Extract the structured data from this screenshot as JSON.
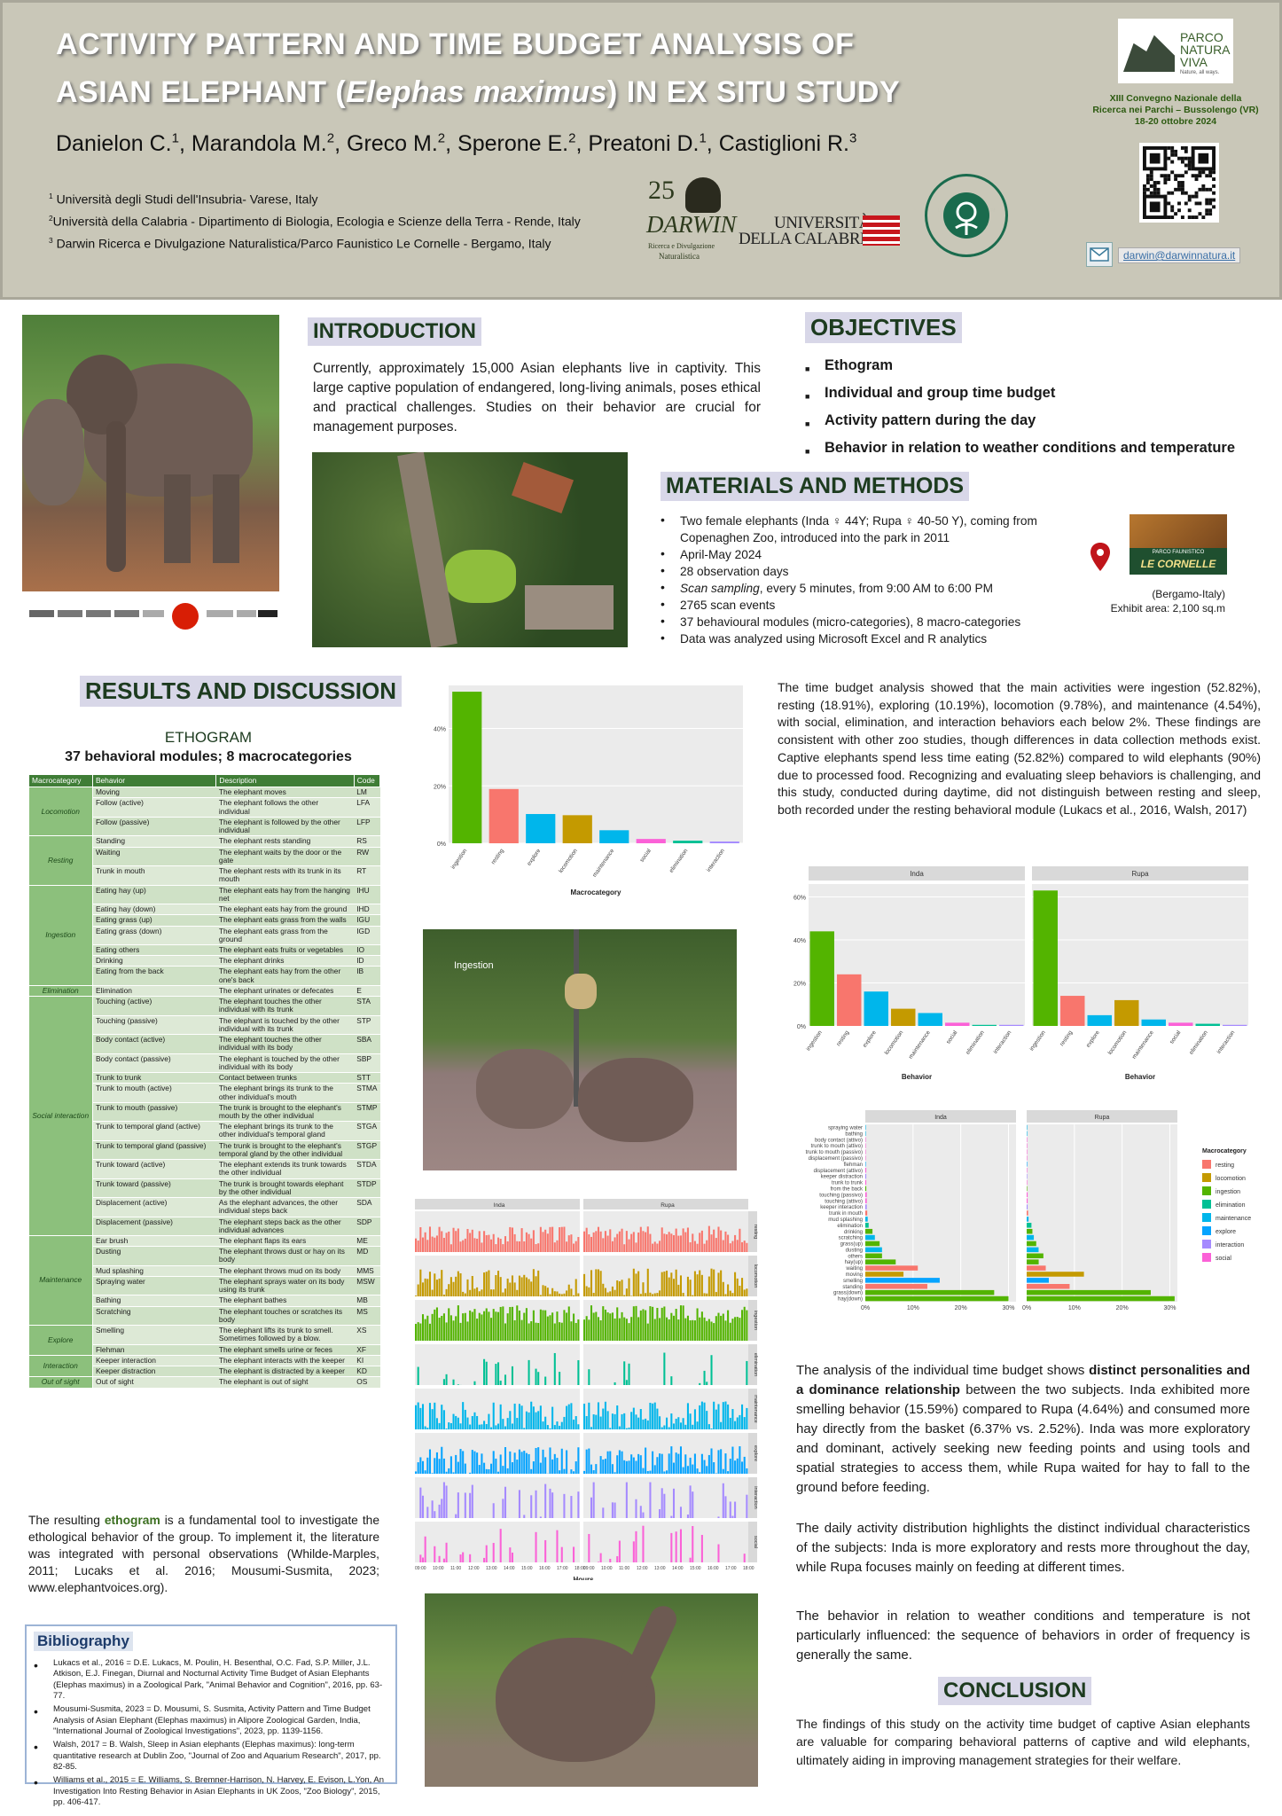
{
  "header": {
    "title_line1": "ACTIVITY PATTERN AND TIME BUDGET ANALYSIS OF",
    "title_line2_pre": "ASIAN ELEPHANT (",
    "title_line2_italic": "Elephas maximus",
    "title_line2_post": ") IN EX SITU STUDY",
    "authors": [
      {
        "name": "Danielon C.",
        "sup": "1"
      },
      {
        "name": "Marandola M.",
        "sup": "2"
      },
      {
        "name": "Greco M.",
        "sup": "2"
      },
      {
        "name": "Sperone E.",
        "sup": "2"
      },
      {
        "name": "Preatoni D.",
        "sup": "1"
      },
      {
        "name": "Castiglioni R.",
        "sup": "3"
      }
    ],
    "affiliations": [
      {
        "sup": "1",
        "text": "Università degli Studi dell'Insubria- Varese, Italy"
      },
      {
        "sup": "2",
        "text": "Università della Calabria - Dipartimento di Biologia, Ecologia e Scienze della Terra - Rende, Italy"
      },
      {
        "sup": "3",
        "text": "Darwin Ricerca e Divulgazione Naturalistica/Parco Faunistico Le Cornelle - Bergamo, Italy"
      }
    ],
    "logo_darwin_num": "25",
    "logo_darwin_name": "DARWIN",
    "logo_darwin_sub1": "Ricerca e Divulgazione",
    "logo_darwin_sub2": "Naturalistica",
    "logo_unical_1": "UNIVERSITÀ",
    "logo_unical_2": "DELLA CALABRIA",
    "logo_insubria_ring": "UNIVERSITAS STUDIORUM INSUBRIAE",
    "logo_parco_1": "PARCO",
    "logo_parco_2": "NATURA",
    "logo_parco_3": "VIVA",
    "logo_parco_tag": "Nature, all ways.",
    "convegno_1": "XIII Convegno Nazionale della",
    "convegno_2": "Ricerca nei Parchi – Bussolengo (VR)",
    "convegno_3": "18-20 ottobre 2024",
    "email": "darwin@darwinnatura.it"
  },
  "intro": {
    "title": "INTRODUCTION",
    "text": "Currently, approximately 15,000 Asian elephants live in captivity. This large captive population of endangered, long-living animals, poses ethical and practical challenges. Studies on their behavior are crucial for management purposes."
  },
  "objectives": {
    "title": "OBJECTIVES",
    "items": [
      "Ethogram",
      "Individual and group time budget",
      "Activity pattern during the day",
      "Behavior in relation to weather conditions and temperature"
    ]
  },
  "methods": {
    "title": "MATERIALS AND METHODS",
    "items": [
      "Two female elephants (Inda ♀ 44Y; Rupa ♀ 40-50 Y), coming from Copenaghen Zoo, introduced into the park in 2011",
      "April-May 2024",
      "28 observation days",
      "Scan sampling, every 5 minutes, from 9:00 AM to 6:00 PM",
      "2765 scan events",
      "37 behavioural modules (micro-categories), 8 macro-categories",
      "Data was analyzed using Microsoft Excel and R analytics"
    ],
    "scan_italic": "Scan sampling",
    "scan_rest": ", every 5 minutes, from 9:00 AM to 6:00 PM",
    "cornelle_logo": "LE CORNELLE",
    "cornelle_small": "PARCO FAUNISTICO",
    "location": "(Bergamo-Italy)",
    "exhibit": "Exhibit area: 2,100 sq.m"
  },
  "results": {
    "title": "RESULTS AND DISCUSSION",
    "ethogram_title": "ETHOGRAM",
    "ethogram_sub": "37 behavioral modules; 8 macrocategories",
    "table_headers": [
      "Macrocategory",
      "Behavior",
      "Description",
      "Code"
    ],
    "table_groups": [
      {
        "macro": "Locomotion",
        "rows": [
          [
            "Moving",
            "The elephant moves",
            "LM"
          ],
          [
            "Follow (active)",
            "The elephant follows the other individual",
            "LFA"
          ],
          [
            "Follow (passive)",
            "The elephant is followed by the other individual",
            "LFP"
          ]
        ]
      },
      {
        "macro": "Resting",
        "rows": [
          [
            "Standing",
            "The elephant rests standing",
            "RS"
          ],
          [
            "Waiting",
            "The elephant waits by the door or the gate",
            "RW"
          ],
          [
            "Trunk in mouth",
            "The elephant rests with its trunk in its mouth",
            "RT"
          ]
        ]
      },
      {
        "macro": "Ingestion",
        "rows": [
          [
            "Eating hay (up)",
            "The elephant eats hay from the hanging net",
            "IHU"
          ],
          [
            "Eating hay (down)",
            "The elephant eats hay from the ground",
            "IHD"
          ],
          [
            "Eating grass (up)",
            "The elephant eats grass from the walls",
            "IGU"
          ],
          [
            "Eating grass (down)",
            "The elephant eats grass from the ground",
            "IGD"
          ],
          [
            "Eating others",
            "The elephant eats fruits or vegetables",
            "IO"
          ],
          [
            "Drinking",
            "The elephant drinks",
            "ID"
          ],
          [
            "Eating from the back",
            "The elephant eats hay from the other one's back",
            "IB"
          ]
        ]
      },
      {
        "macro": "Elimination",
        "rows": [
          [
            "Elimination",
            "The elephant urinates or defecates",
            "E"
          ]
        ]
      },
      {
        "macro": "Social interaction",
        "rows": [
          [
            "Touching (active)",
            "The elephant touches the other individual with its trunk",
            "STA"
          ],
          [
            "Touching (passive)",
            "The elephant is touched by the other individual with its trunk",
            "STP"
          ],
          [
            "Body contact (active)",
            "The elephant touches the other individual with its body",
            "SBA"
          ],
          [
            "Body contact (passive)",
            "The elephant is touched by the other individual with its body",
            "SBP"
          ],
          [
            "Trunk to trunk",
            "Contact between trunks",
            "STT"
          ],
          [
            "Trunk to mouth (active)",
            "The elephant brings its trunk to the other individual's mouth",
            "STMA"
          ],
          [
            "Trunk to mouth (passive)",
            "The trunk is brought to the elephant's mouth by the other individual",
            "STMP"
          ],
          [
            "Trunk to temporal gland (active)",
            "The elephant brings its trunk to the other individual's temporal gland",
            "STGA"
          ],
          [
            "Trunk to temporal gland (passive)",
            "The trunk is brought to the elephant's temporal gland by the other individual",
            "STGP"
          ],
          [
            "Trunk toward (active)",
            "The elephant extends its trunk towards the other individual",
            "STDA"
          ],
          [
            "Trunk toward (passive)",
            "The trunk is brought towards elephant by the other individual",
            "STDP"
          ],
          [
            "Displacement (active)",
            "As the elephant advances, the other individual steps back",
            "SDA"
          ],
          [
            "Displacement (passive)",
            "The elephant steps back as the other individual advances",
            "SDP"
          ]
        ]
      },
      {
        "macro": "Maintenance",
        "rows": [
          [
            "Ear brush",
            "The elephant flaps its ears",
            "ME"
          ],
          [
            "Dusting",
            "The elephant throws dust or hay on its body",
            "MD"
          ],
          [
            "Mud splashing",
            "The elephant throws mud on its body",
            "MMS"
          ],
          [
            "Spraying water",
            "The elephant sprays water on its body using its trunk",
            "MSW"
          ],
          [
            "Bathing",
            "The elephant bathes",
            "MB"
          ],
          [
            "Scratching",
            "The elephant touches or scratches its body",
            "MS"
          ]
        ]
      },
      {
        "macro": "Explore",
        "rows": [
          [
            "Smelling",
            "The elephant lifts its trunk to smell. Sometimes followed by a blow.",
            "XS"
          ],
          [
            "Flehman",
            "The elephant smells urine or feces",
            "XF"
          ]
        ]
      },
      {
        "macro": "Interaction",
        "rows": [
          [
            "Keeper interaction",
            "The elephant interacts with the keeper",
            "KI"
          ],
          [
            "Keeper distraction",
            "The elephant is distracted by a keeper",
            "KD"
          ]
        ]
      },
      {
        "macro": "Out of sight",
        "rows": [
          [
            "Out of sight",
            "The elephant is out of sight",
            "OS"
          ]
        ]
      }
    ],
    "ethogram_text_pre": "The resulting ",
    "ethogram_text_bold": "ethogram",
    "ethogram_text_post": " is a fundamental tool to investigate the ethological behavior of the group. To implement it, the literature was integrated with personal observations (Whilde-Marples, 2011; Lucaks et al. 2016; Mousumi-Susmita, 2023; www.elephantvoices.org).",
    "photo_label_ingestion": "Ingestion",
    "time_budget_text": "The time budget analysis showed that the main activities were ingestion (52.82%), resting (18.91%), exploring (10.19%), locomotion (9.78%), and maintenance (4.54%), with social, elimination, and interaction behaviors each below 2%. These findings are consistent with other zoo studies, though differences in data collection methods exist. Captive elephants spend less time eating (52.82%) compared to wild elephants (90%) due to processed food. Recognizing and evaluating sleep behaviors is challenging, and this study, conducted during daytime, did not distinguish between resting and sleep, both recorded under the resting behavioral module (Lukacs et al., 2016, Walsh, 2017)",
    "individual_text_1": "The analysis of the individual time budget shows ",
    "individual_text_bold": "distinct personalities and a dominance relationship",
    "individual_text_2": " between the two subjects. Inda exhibited more smelling behavior (15.59%) compared to Rupa (4.64%) and consumed more hay directly from the basket (6.37% vs. 2.52%). Inda was more exploratory and dominant, actively seeking new feeding points and using tools and spatial strategies to access them, while Rupa waited for hay to fall to the ground before feeding.",
    "daily_text": "The daily activity distribution highlights the distinct individual characteristics of the subjects: Inda is more exploratory and rests more throughout the day, while Rupa focuses mainly on feeding at different times.",
    "weather_text": "The behavior in relation to weather conditions and temperature is not particularly influenced: the sequence of behaviors in order of frequency is generally the same."
  },
  "conclusion": {
    "title": "CONCLUSION",
    "text": "The findings of this study on the activity time budget of captive Asian elephants are valuable for comparing behavioral patterns of captive and wild elephants, ultimately aiding in improving management strategies for their welfare."
  },
  "bibliography": {
    "title": "Bibliography",
    "items": [
      "Lukacs et al., 2016 = D.E. Lukacs, M. Poulin, H. Besenthal, O.C. Fad, S.P. Miller, J.L. Atkison, E.J. Finegan, Diurnal and Nocturnal Activity Time Budget of Asian Elephants (Elephas maximus) in a Zoological Park, \"Animal Behavior and Cognition\", 2016, pp. 63-77.",
      "Mousumi-Susmita, 2023 = D. Mousumi, S. Susmita, Activity Pattern and Time Budget Analysis of Asian Elephant (Elephas maximus) in Alipore Zoological Garden, India, \"International Journal of Zoological Investigations\", 2023, pp. 1139-1156.",
      "Walsh, 2017 = B. Walsh, Sleep in Asian elephants (Elephas maximus): long-term quantitative research at Dublin Zoo, \"Journal of Zoo and Aquarium Research\", 2017, pp. 82-85.",
      "Williams et al., 2015 = E. Williams, S. Bremner-Harrison, N. Harvey, E. Evison, L.Yon, An Investigation Into Resting Behavior in Asian Elephants in UK Zoos, \"Zoo Biology\", 2015, pp. 406-417."
    ]
  },
  "colors": {
    "resting": "#f8766d",
    "locomotion": "#c49a00",
    "ingestion": "#53b400",
    "elimination": "#00c094",
    "maintenance": "#00b6eb",
    "explore": "#06a4ff",
    "interaction": "#a58aff",
    "social": "#fb61d7"
  },
  "chart_data": [
    {
      "type": "bar",
      "title": "",
      "xlabel": "Macrocategory",
      "ylabel": "",
      "categories": [
        "ingestion",
        "resting",
        "explore",
        "locomotion",
        "maintenance",
        "social",
        "elimination",
        "interaction"
      ],
      "values": [
        52.82,
        18.91,
        10.19,
        9.78,
        4.54,
        1.5,
        0.9,
        0.6
      ],
      "ylim": [
        0,
        55
      ],
      "yticks": [
        "0%",
        "20%",
        "40%"
      ],
      "grid": true
    },
    {
      "type": "bar",
      "title": "",
      "xlabel": "Behavior",
      "panels": [
        "Inda",
        "Rupa"
      ],
      "categories": [
        "ingestion",
        "resting",
        "explore",
        "locomotion",
        "maintenance",
        "social",
        "elimination",
        "interaction"
      ],
      "series": [
        {
          "name": "Inda",
          "values": [
            44,
            24,
            16,
            8,
            6,
            1.5,
            0.5,
            0.5
          ]
        },
        {
          "name": "Rupa",
          "values": [
            63,
            14,
            5,
            12,
            3,
            1.5,
            1,
            0.5
          ]
        }
      ],
      "ylim": [
        0,
        66
      ],
      "yticks": [
        "0%",
        "20%",
        "40%",
        "60%"
      ],
      "grid": true
    },
    {
      "type": "bar",
      "title": "",
      "legend_title": "Macrocategory",
      "legend": [
        "resting",
        "locomotion",
        "ingestion",
        "elimination",
        "maintenance",
        "explore",
        "interaction",
        "social"
      ],
      "panels": [
        "Inda",
        "Rupa"
      ],
      "categories": [
        "spraying water",
        "bathing",
        "body contact (attivo)",
        "trunk to mouth (attivo)",
        "trunk to mouth (passivo)",
        "displacement (passivo)",
        "flehman",
        "displacement (attivo)",
        "keeper distraction",
        "trunk to trunk",
        "from the back",
        "touching (passivo)",
        "touching (attivo)",
        "keeper interaction",
        "trunk in mouth",
        "mud splashing",
        "elimination",
        "drinking",
        "scratching",
        "grass(up)",
        "dusting",
        "others",
        "hay(up)",
        "waiting",
        "moving",
        "smelling",
        "standing",
        "grass(down)",
        "hay(down)"
      ],
      "category_macro": [
        "maintenance",
        "maintenance",
        "social",
        "social",
        "social",
        "social",
        "explore",
        "social",
        "interaction",
        "social",
        "ingestion",
        "social",
        "social",
        "interaction",
        "resting",
        "maintenance",
        "elimination",
        "ingestion",
        "maintenance",
        "ingestion",
        "maintenance",
        "ingestion",
        "ingestion",
        "resting",
        "locomotion",
        "explore",
        "resting",
        "ingestion",
        "ingestion"
      ],
      "series": [
        {
          "name": "Inda",
          "values": [
            0.1,
            0.1,
            0.1,
            0.1,
            0.1,
            0.1,
            0.1,
            0.2,
            0.2,
            0.2,
            0.2,
            0.3,
            0.3,
            0.3,
            0.4,
            0.5,
            0.7,
            1.5,
            2,
            3,
            3.5,
            3.5,
            6.37,
            11,
            8,
            15.59,
            13,
            27,
            30
          ]
        },
        {
          "name": "Rupa",
          "values": [
            0.1,
            0.1,
            0.1,
            0.1,
            0.1,
            0.1,
            0.1,
            0.1,
            0.1,
            0.1,
            0.1,
            0.2,
            0.2,
            0.2,
            0.3,
            0.4,
            1,
            1.2,
            1.5,
            2,
            2.5,
            3.5,
            2.52,
            4,
            12,
            4.64,
            9,
            26,
            31
          ]
        }
      ],
      "xlim": [
        0,
        30
      ],
      "xticks": [
        "0%",
        "10%",
        "20%",
        "30%"
      ],
      "grid": true
    },
    {
      "type": "bar",
      "title": "",
      "xlabel": "Hours",
      "panels": [
        "Inda",
        "Rupa"
      ],
      "rows": [
        "resting",
        "locomotion",
        "ingestion",
        "elimination",
        "maintenance",
        "explore",
        "interaction",
        "social"
      ],
      "x": [
        "09:00",
        "10:00",
        "11:00",
        "12:00",
        "13:00",
        "14:00",
        "15:00",
        "16:00",
        "17:00",
        "18:00"
      ],
      "row_max": [
        15,
        10,
        20,
        2,
        5,
        8,
        2,
        3
      ]
    }
  ]
}
